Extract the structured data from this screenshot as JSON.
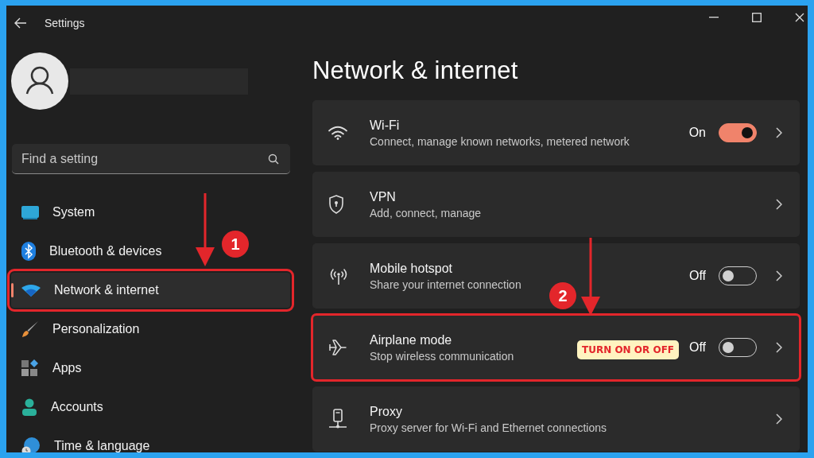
{
  "window": {
    "title": "Settings"
  },
  "search": {
    "placeholder": "Find a setting"
  },
  "sidebar": {
    "items": [
      {
        "label": "System",
        "selected": false,
        "highlighted": false
      },
      {
        "label": "Bluetooth & devices",
        "selected": false,
        "highlighted": false
      },
      {
        "label": "Network & internet",
        "selected": true,
        "highlighted": true
      },
      {
        "label": "Personalization",
        "selected": false,
        "highlighted": false
      },
      {
        "label": "Apps",
        "selected": false,
        "highlighted": false
      },
      {
        "label": "Accounts",
        "selected": false,
        "highlighted": false
      },
      {
        "label": "Time & language",
        "selected": false,
        "highlighted": false
      }
    ]
  },
  "page": {
    "heading": "Network & internet"
  },
  "cards": [
    {
      "kind": "toggle",
      "title": "Wi-Fi",
      "subtitle": "Connect, manage known networks, metered network",
      "state_label": "On",
      "on": true,
      "highlighted": false
    },
    {
      "kind": "link",
      "title": "VPN",
      "subtitle": "Add, connect, manage",
      "highlighted": false
    },
    {
      "kind": "toggle",
      "title": "Mobile hotspot",
      "subtitle": "Share your internet connection",
      "state_label": "Off",
      "on": false,
      "highlighted": false
    },
    {
      "kind": "toggle",
      "title": "Airplane mode",
      "subtitle": "Stop wireless communication",
      "state_label": "Off",
      "on": false,
      "highlighted": true
    },
    {
      "kind": "link",
      "title": "Proxy",
      "subtitle": "Proxy server for Wi-Fi and Ethernet connections",
      "highlighted": false
    }
  ],
  "annotations": [
    {
      "kind": "step",
      "number": "1"
    },
    {
      "kind": "step",
      "number": "2"
    },
    {
      "kind": "callout",
      "text": "TURN ON OR OFF"
    }
  ]
}
